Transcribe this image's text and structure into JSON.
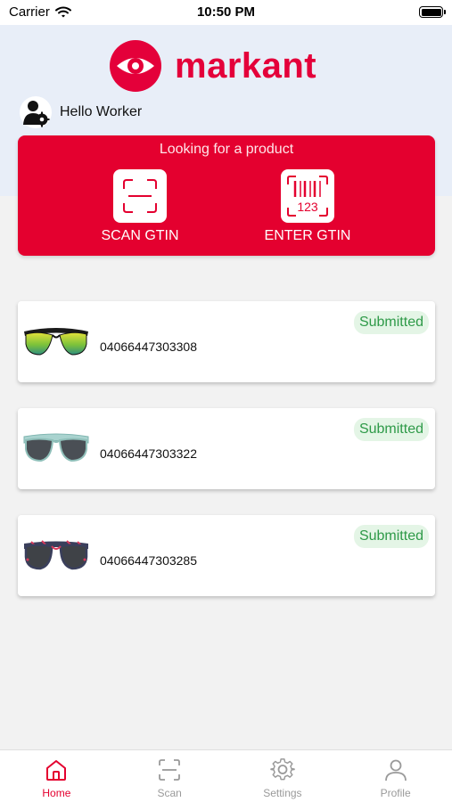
{
  "status_bar": {
    "carrier": "Carrier",
    "time": "10:50 PM"
  },
  "brand": {
    "name": "markant",
    "color": "#e4003a"
  },
  "greeting": {
    "text": "Hello Worker",
    "icon": "worker-settings-icon"
  },
  "search_card": {
    "title": "Looking for a product",
    "scan": {
      "label": "SCAN GTIN",
      "icon": "scan-frame-icon"
    },
    "enter": {
      "label": "ENTER GTIN",
      "icon": "barcode-123-icon"
    }
  },
  "products": [
    {
      "gtin": "04066447303308",
      "status": "Submitted",
      "image": "sunglasses-mirrored-green"
    },
    {
      "gtin": "04066447303322",
      "status": "Submitted",
      "image": "sunglasses-clear-frame"
    },
    {
      "gtin": "04066447303285",
      "status": "Submitted",
      "image": "sunglasses-patterned-frame"
    }
  ],
  "tabs": [
    {
      "label": "Home",
      "icon": "home-icon",
      "active": true
    },
    {
      "label": "Scan",
      "icon": "scan-icon",
      "active": false
    },
    {
      "label": "Settings",
      "icon": "gear-icon",
      "active": false
    },
    {
      "label": "Profile",
      "icon": "person-icon",
      "active": false
    }
  ],
  "colors": {
    "accent": "#e4002f",
    "status_green": "#2e9a48",
    "status_green_bg": "#e4f5e6"
  }
}
